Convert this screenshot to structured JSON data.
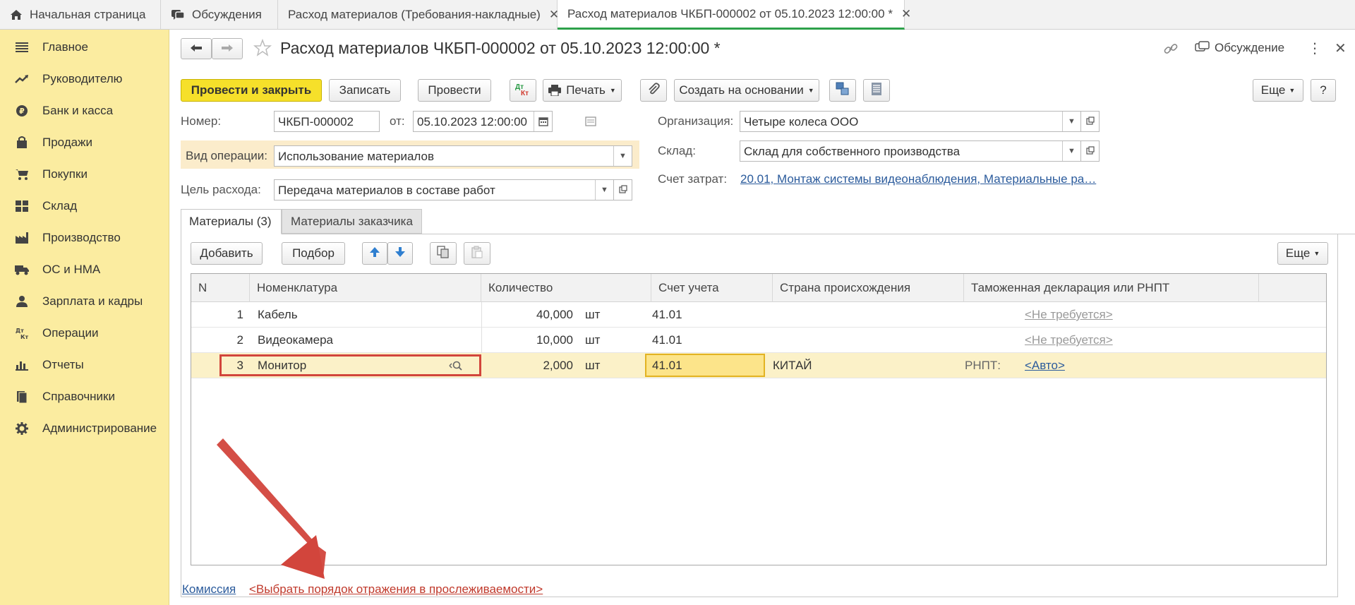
{
  "tabs": [
    {
      "label": "Начальная страница"
    },
    {
      "label": "Обсуждения"
    },
    {
      "label": "Расход материалов (Требования-накладные)"
    },
    {
      "label": "Расход материалов ЧКБП-000002 от 05.10.2023 12:00:00 *"
    }
  ],
  "sidebar": {
    "items": [
      {
        "label": "Главное",
        "icon": "menu-icon"
      },
      {
        "label": "Руководителю",
        "icon": "trend-icon"
      },
      {
        "label": "Банк и касса",
        "icon": "ruble-icon"
      },
      {
        "label": "Продажи",
        "icon": "bag-icon"
      },
      {
        "label": "Покупки",
        "icon": "cart-icon"
      },
      {
        "label": "Склад",
        "icon": "warehouse-icon"
      },
      {
        "label": "Производство",
        "icon": "factory-icon"
      },
      {
        "label": "ОС и НМА",
        "icon": "truck-icon"
      },
      {
        "label": "Зарплата и кадры",
        "icon": "person-icon"
      },
      {
        "label": "Операции",
        "icon": "dt-kt-icon"
      },
      {
        "label": "Отчеты",
        "icon": "bar-chart-icon"
      },
      {
        "label": "Справочники",
        "icon": "books-icon"
      },
      {
        "label": "Администрирование",
        "icon": "gear-icon"
      }
    ]
  },
  "form": {
    "title": "Расход материалов ЧКБП-000002 от 05.10.2023 12:00:00 *",
    "discussion": "Обсуждение",
    "toolbar": {
      "post_close": "Провести и закрыть",
      "save": "Записать",
      "post": "Провести",
      "dtkt_top": "Дт",
      "dtkt_bottom": "Кт",
      "print": "Печать",
      "create_based": "Создать на основании",
      "more": "Еще",
      "help": "?"
    },
    "number_label": "Номер:",
    "number_value": "ЧКБП-000002",
    "date_label": "от:",
    "date_value": "05.10.2023 12:00:00",
    "org_label": "Организация:",
    "org_value": "Четыре колеса ООО",
    "warehouse_label": "Склад:",
    "warehouse_value": "Склад для собственного производства",
    "op_type_label": "Вид операции:",
    "op_type_value": "Использование материалов",
    "purpose_label": "Цель расхода:",
    "purpose_value": "Передача материалов в составе работ",
    "cost_account_label": "Счет затрат:",
    "cost_account_value": "20.01, Монтаж системы видеонаблюдения, Материальные ра…"
  },
  "subtabs": [
    {
      "label": "Материалы (3)"
    },
    {
      "label": "Материалы заказчика"
    }
  ],
  "table_toolbar": {
    "add": "Добавить",
    "pick": "Подбор",
    "more": "Еще"
  },
  "table": {
    "columns": [
      "N",
      "Номенклатура",
      "Количество",
      "Счет учета",
      "Страна происхождения",
      "Таможенная декларация или РНПТ"
    ],
    "rows": [
      {
        "n": "1",
        "item": "Кабель",
        "qty": "40,000",
        "unit": "шт",
        "account": "41.01",
        "country": "",
        "rnpt": "",
        "customs": "<Не требуется>"
      },
      {
        "n": "2",
        "item": "Видеокамера",
        "qty": "10,000",
        "unit": "шт",
        "account": "41.01",
        "country": "",
        "rnpt": "",
        "customs": "<Не требуется>"
      },
      {
        "n": "3",
        "item": "Монитор",
        "qty": "2,000",
        "unit": "шт",
        "account": "41.01",
        "country": "КИТАЙ",
        "rnpt": "РНПТ:",
        "customs": "<Авто>"
      }
    ]
  },
  "footer": {
    "commission": "Комиссия",
    "traceability": "<Выбрать порядок отражения в прослеживаемости>"
  },
  "colors": {
    "sidebar_bg": "#fbeca0",
    "primary_button": "#f6e02a",
    "selected_row": "#fbf1c8",
    "highlight_box": "#d2453c",
    "link": "#2b5b9c"
  }
}
